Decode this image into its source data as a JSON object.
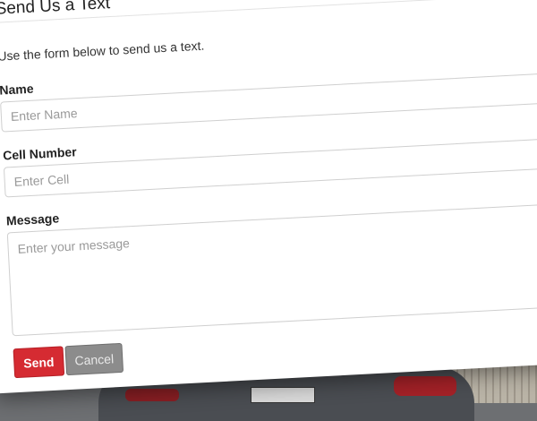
{
  "modal": {
    "title": "Send Us a Text",
    "intro": "Use the form below to send us a text."
  },
  "form": {
    "name": {
      "label": "Name",
      "placeholder": "Enter Name",
      "value": ""
    },
    "cell": {
      "label": "Cell Number",
      "placeholder": "Enter Cell",
      "value": ""
    },
    "message": {
      "label": "Message",
      "placeholder": "Enter your message",
      "value": ""
    }
  },
  "buttons": {
    "send_label": "Send",
    "cancel_label": "Cancel"
  },
  "colors": {
    "send_button": "#d52b32",
    "cancel_button": "#8c8c8c"
  }
}
